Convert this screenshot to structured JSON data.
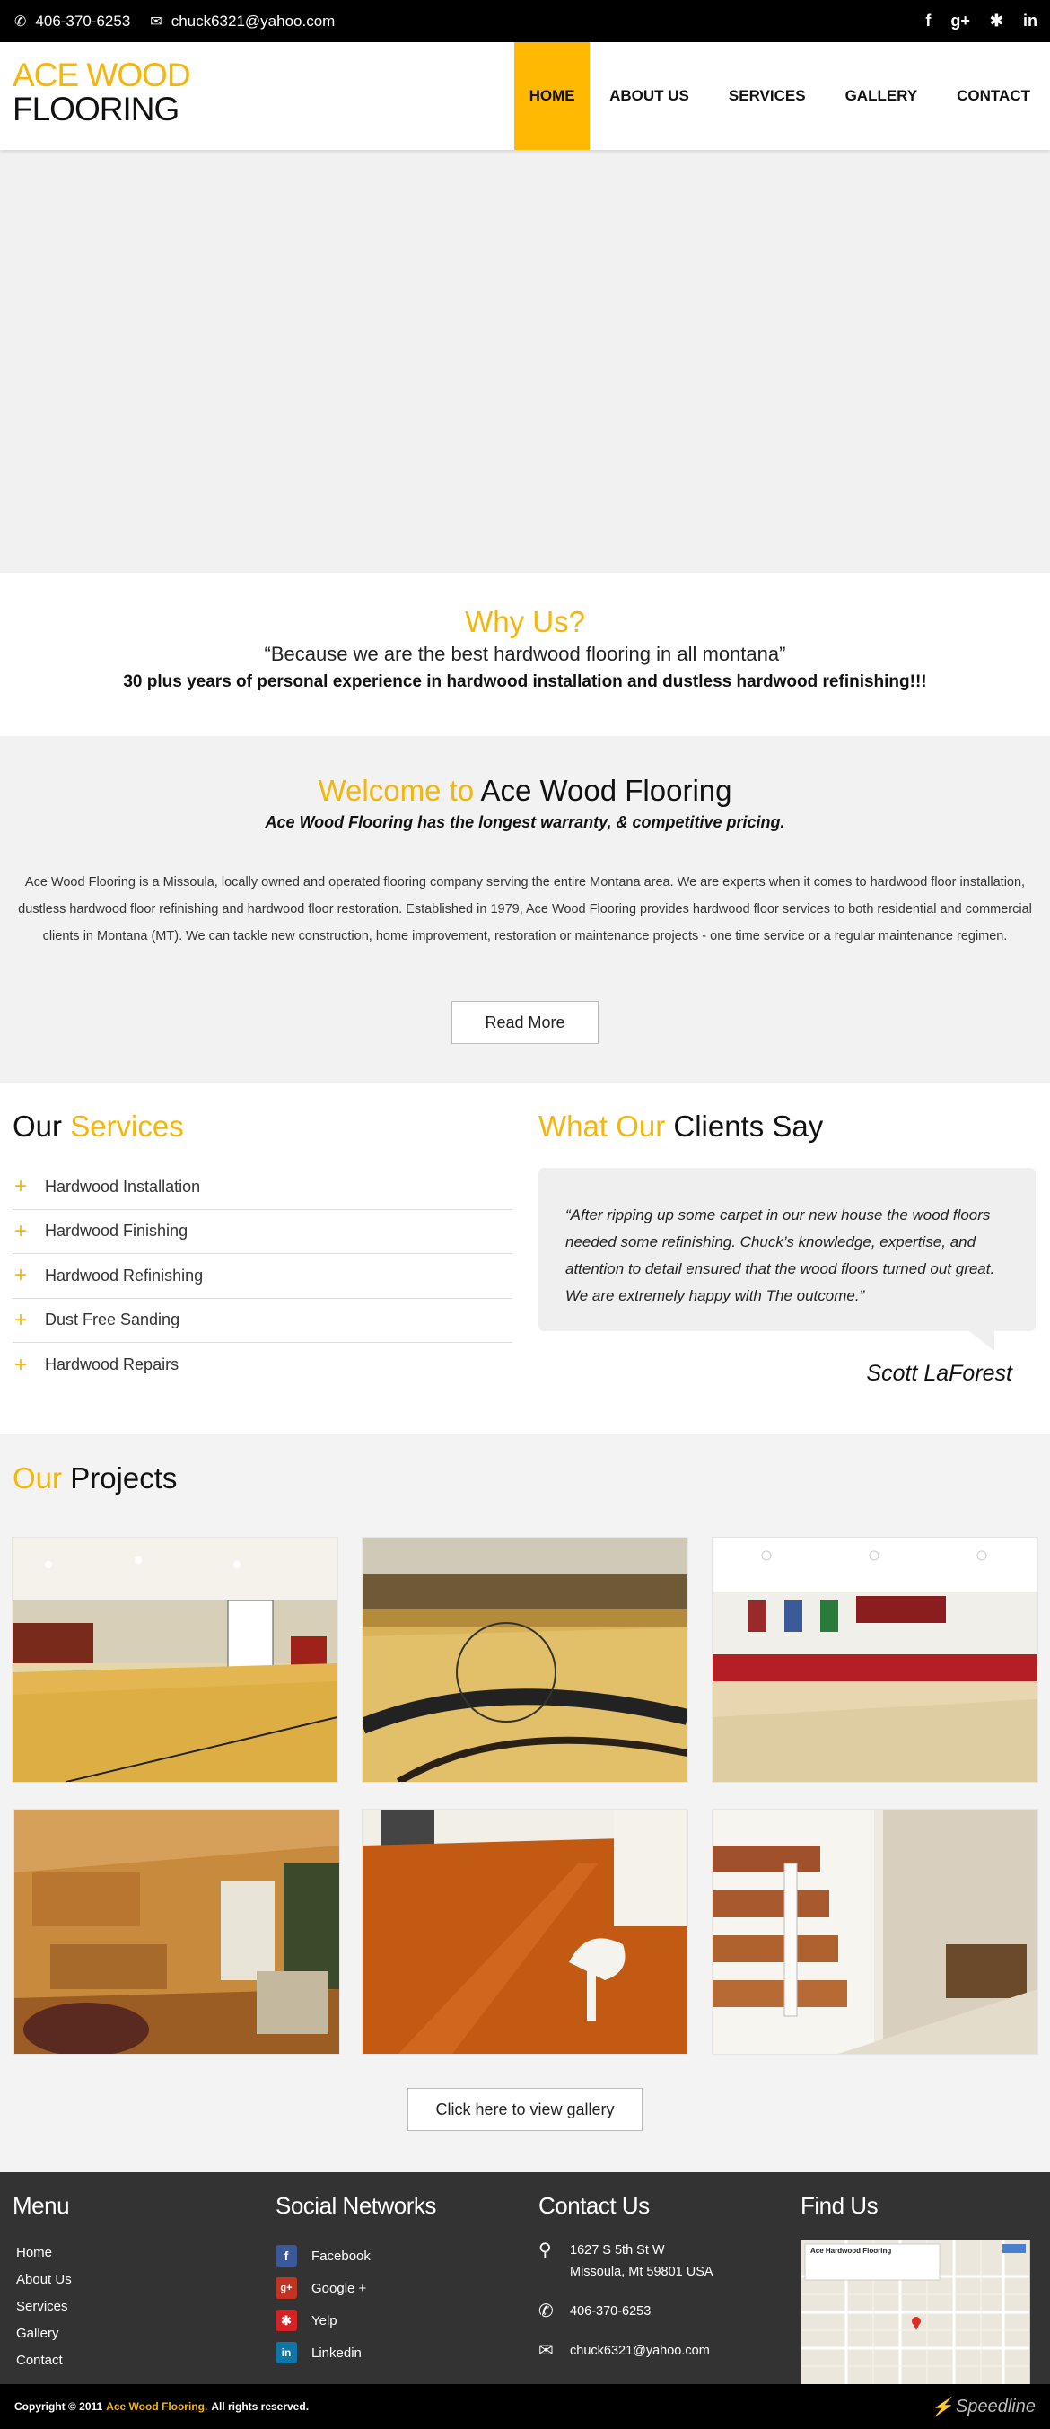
{
  "topbar": {
    "phone": "406-370-6253",
    "email": "chuck6321@yahoo.com",
    "social": [
      "f",
      "g+",
      "y",
      "in"
    ]
  },
  "logo": {
    "line1": "ACE WOOD",
    "line2": "FLOORING"
  },
  "nav": [
    "HOME",
    "ABOUT US",
    "SERVICES",
    "GALLERY",
    "CONTACT"
  ],
  "colors": {
    "accent": "#f5b50b",
    "nav_active": "#ffb902",
    "footer": "#333333"
  },
  "why": {
    "title": "Why Us?",
    "quote": "“Because we are the best hardwood flooring in all montana”",
    "sub": "30 plus years of personal experience in hardwood installation and dustless hardwood refinishing!!!"
  },
  "welcome": {
    "title_accent": "Welcome to",
    "title_rest": "Ace Wood Flooring",
    "tagline": "Ace Wood Flooring has the longest warranty, & competitive pricing.",
    "body": "Ace Wood Flooring is a Missoula, locally owned and operated flooring company serving the entire Montana area. We are experts when it comes to hardwood floor installation, dustless hardwood floor refinishing and hardwood floor restoration. Established in 1979, Ace Wood Flooring provides hardwood floor services to both residential and commercial clients in Montana (MT). We can tackle new construction, home improvement, restoration or maintenance projects - one time service or a regular maintenance regimen.",
    "button": "Read More"
  },
  "services": {
    "title_plain": "Our",
    "title_accent": "Services",
    "items": [
      "Hardwood Installation",
      "Hardwood Finishing",
      "Hardwood Refinishing",
      "Dust Free Sanding",
      "Hardwood Repairs"
    ]
  },
  "testimonial": {
    "title_accent": "What Our",
    "title_plain": "Clients Say",
    "quote": "“After ripping up some carpet in our new house the wood floors needed some refinishing. Chuck’s knowledge, expertise, and attention to detail ensured that the wood floors turned out great. We are extremely happy with The outcome.”",
    "author": "Scott LaForest"
  },
  "projects": {
    "title_accent": "Our",
    "title_plain": "Projects",
    "button": "Click here to view gallery"
  },
  "footer": {
    "menu_title": "Menu",
    "menu": [
      "Home",
      "About Us",
      "Services",
      "Gallery",
      "Contact"
    ],
    "social_title": "Social Networks",
    "social": [
      "Facebook",
      "Google +",
      "Yelp",
      "Linkedin"
    ],
    "contact_title": "Contact Us",
    "address_line1": "1627 S 5th St W",
    "address_line2": "Missoula, Mt 59801 USA",
    "phone": "406-370-6253",
    "email": "chuck6321@yahoo.com",
    "find_title": "Find Us",
    "map_label": "Ace Hardwood Flooring"
  },
  "bottom": {
    "copy_prefix": "Copyright © 2011",
    "copy_brand": "Ace Wood Flooring.",
    "copy_suffix": "All rights reserved.",
    "brand": "Speedline"
  }
}
